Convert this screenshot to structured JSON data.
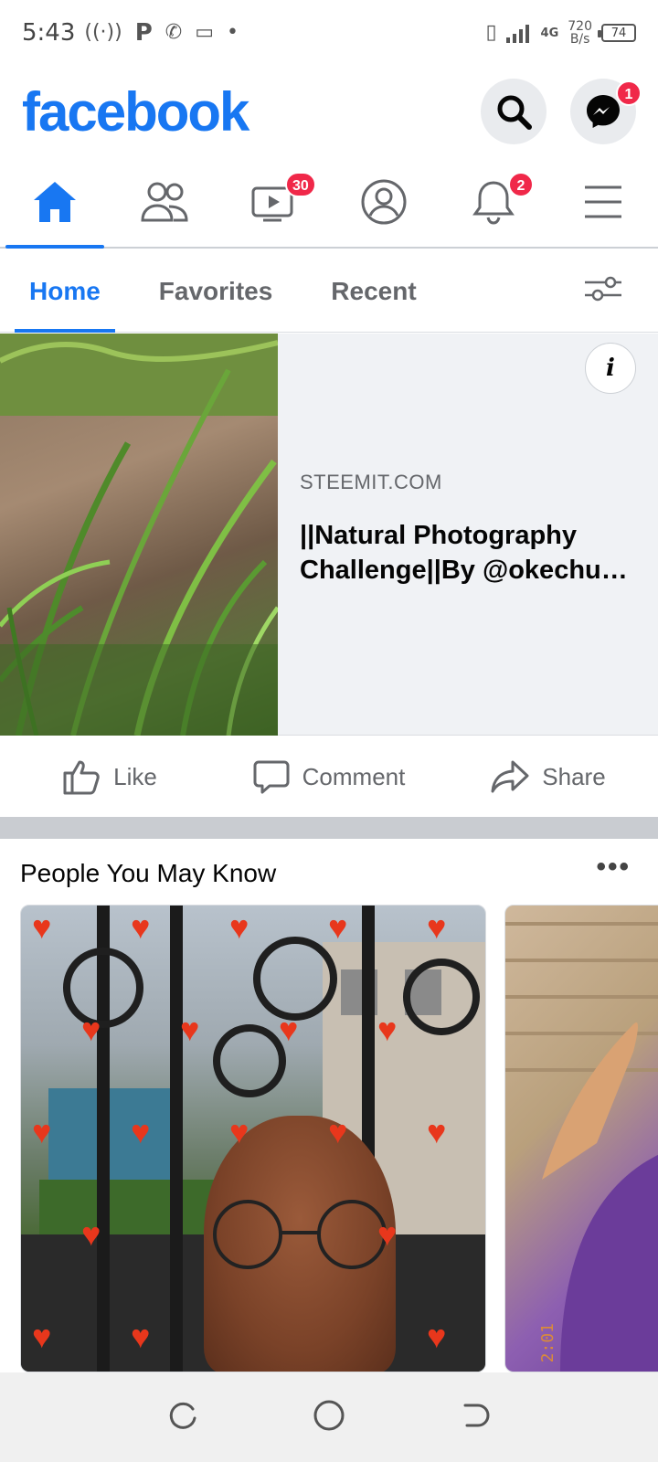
{
  "status_bar": {
    "time": "5:43",
    "network": "4G",
    "speed_value": "720",
    "speed_unit": "B/s",
    "battery": "74"
  },
  "header": {
    "logo": "facebook",
    "messenger_badge": "1"
  },
  "nav": {
    "watch_badge": "30",
    "notifications_badge": "2"
  },
  "subtabs": {
    "home": "Home",
    "favorites": "Favorites",
    "recent": "Recent"
  },
  "link_card": {
    "domain": "STEEMIT.COM",
    "title": "||Natural Photography Challenge||By @okechu…",
    "info": "i"
  },
  "actions": {
    "like": "Like",
    "comment": "Comment",
    "share": "Share"
  },
  "pymk": {
    "title": "People You May Know",
    "more": "•••",
    "card2_stamp": "2:01"
  },
  "colors": {
    "brand": "#1877f2",
    "badge": "#f02849"
  }
}
